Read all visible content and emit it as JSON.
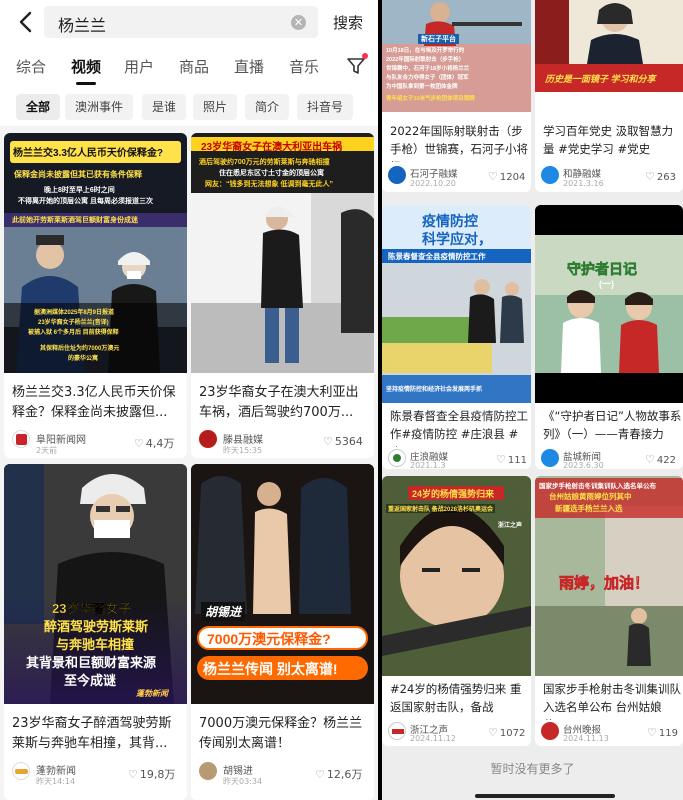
{
  "search": {
    "query": "杨兰兰",
    "button": "搜索"
  },
  "tabs": [
    "综合",
    "视频",
    "用户",
    "商品",
    "直播",
    "音乐"
  ],
  "chips": [
    "全部",
    "澳洲事件",
    "是谁",
    "照片",
    "简介",
    "抖音号"
  ],
  "left_cards": [
    {
      "title": "杨兰兰交3.3亿人民币天价保释金？保释金尚未披露但...",
      "author": "阜阳新闻网",
      "ago": "2天前",
      "likes": "4,4万",
      "overlay": {
        "headline": "杨兰兰交3.3亿人民币天价保释金?",
        "line2": "保释金尚未披露但其已获有条件保释",
        "line3": "晚上8时至早上6时之间",
        "line4": "不得离开她的顶层公寓 且每周必须报道三次",
        "line5": "此前她开劳斯莱斯酒驾巨额财富身份成迷",
        "caption": "据澳洲媒体2025年8月9日报道",
        "caption2": "23岁华裔女子杨兰兰(音译)",
        "caption3": "被捕入狱 6个多月后 目前获得保释",
        "caption4": "其保释后住址为约7000万澳元",
        "caption5": "的豪华公寓"
      }
    },
    {
      "title": "23岁华裔女子在澳大利亚出车祸，酒后驾驶约700万...",
      "author": "滕县融媒",
      "ago": "昨天15:35",
      "likes": "5364",
      "overlay": {
        "headline": "23岁华裔女子在澳大利亚出车祸",
        "line2": "酒后驾驶约700万元的劳斯莱斯与奔驰相撞",
        "line3": "住在悉尼东区寸土寸金的顶层公寓",
        "line4": "网友：“钱多到无法想象 低调到毫无此人”"
      }
    },
    {
      "title": "23岁华裔女子醉酒驾驶劳斯莱斯与奔驰车相撞，其背...",
      "author": "蓬勃新闻",
      "ago": "昨天14:14",
      "likes": "19,8万",
      "overlay": {
        "line1": "23岁华裔女子",
        "line2": "醉酒驾驶劳斯莱斯",
        "line3": "与奔驰车相撞",
        "line4": "其背景和巨额财富来源",
        "line5": "至今成谜",
        "logo": "蓬勃新闻"
      }
    },
    {
      "title": "7000万澳元保释金？杨兰兰传闻别太离谱！",
      "author": "胡锡进",
      "ago": "昨天03:34",
      "likes": "12,6万",
      "overlay": {
        "name": "胡锡进",
        "line1": "7000万澳元保释金?",
        "line2": "杨兰兰传闻 别太离谱!"
      }
    }
  ],
  "right_cards": [
    {
      "title": "2022年国际射联射击（步手枪）世锦赛，石河子小将杨...",
      "author": "石河子融媒",
      "ago": "2022.10.20",
      "likes": "1204",
      "overlay": {
        "line1": "10月18日，在与埃及开罗举行的",
        "line2": "2022年国际射联射击（步手枪）",
        "line3": "世锦赛中，石河子18岁小将杨兰兰",
        "line4": "与队友合力夺得女子（团体）冠军",
        "line5": "为中国队拿到第一枚团体金牌",
        "line6": "青年组女子10米气步枪团体项目银牌",
        "badge": "新石子平台"
      }
    },
    {
      "title": "学习百年党史 汲取智慧力量 #党史学习 #党史",
      "author": "和静融媒",
      "ago": "2021.3.16",
      "likes": "263",
      "overlay": {
        "banner": "历史是一面镜子 学习和分享"
      }
    },
    {
      "title": "陈景春督查全县疫情防控工作#疫情防控 #庄浪县 #疫...",
      "author": "庄浪融媒",
      "ago": "2021.1.3",
      "likes": "111",
      "overlay": {
        "line1": "疫情防控",
        "line2": "科学应对，",
        "line3": "陈景春督查全县疫情防控工作",
        "line4": "坚持疫情防控和经济社会发展两手抓"
      }
    },
    {
      "title": "《“守护者日记”人物故事系列》（一）——青春接力 用...",
      "author": "盐城新闻",
      "ago": "2023.6.30",
      "likes": "422",
      "overlay": {
        "line1": "守护者日记",
        "line2": "(一)"
      }
    },
    {
      "title": "#24岁的杨倩强势归来 重返国家射击队，备战#2028...",
      "author": "浙江之声",
      "ago": "2024.11.12",
      "likes": "1072",
      "overlay": {
        "line1": "24岁的杨倩强势归来",
        "line2": "重返国家射击队 备战2028洛杉矶奥运会",
        "mark": "浙江之声"
      }
    },
    {
      "title": "国家步手枪射击冬训集训队入选名单公布 台州姑娘 黄...",
      "author": "台州晚报",
      "ago": "2024.11.13",
      "likes": "119",
      "overlay": {
        "line1": "国家步手枪射击冬训集训队入选名单公布",
        "line2": "台州姑娘黄雨婷位列其中",
        "line3": "新疆选手杨兰兰入选",
        "line4": "雨婷，加油！"
      }
    }
  ],
  "footer": {
    "no_more": "暂时没有更多了"
  },
  "colors": {
    "accent": "#ff2d4f",
    "like": "#888888",
    "divider": "#000000"
  }
}
